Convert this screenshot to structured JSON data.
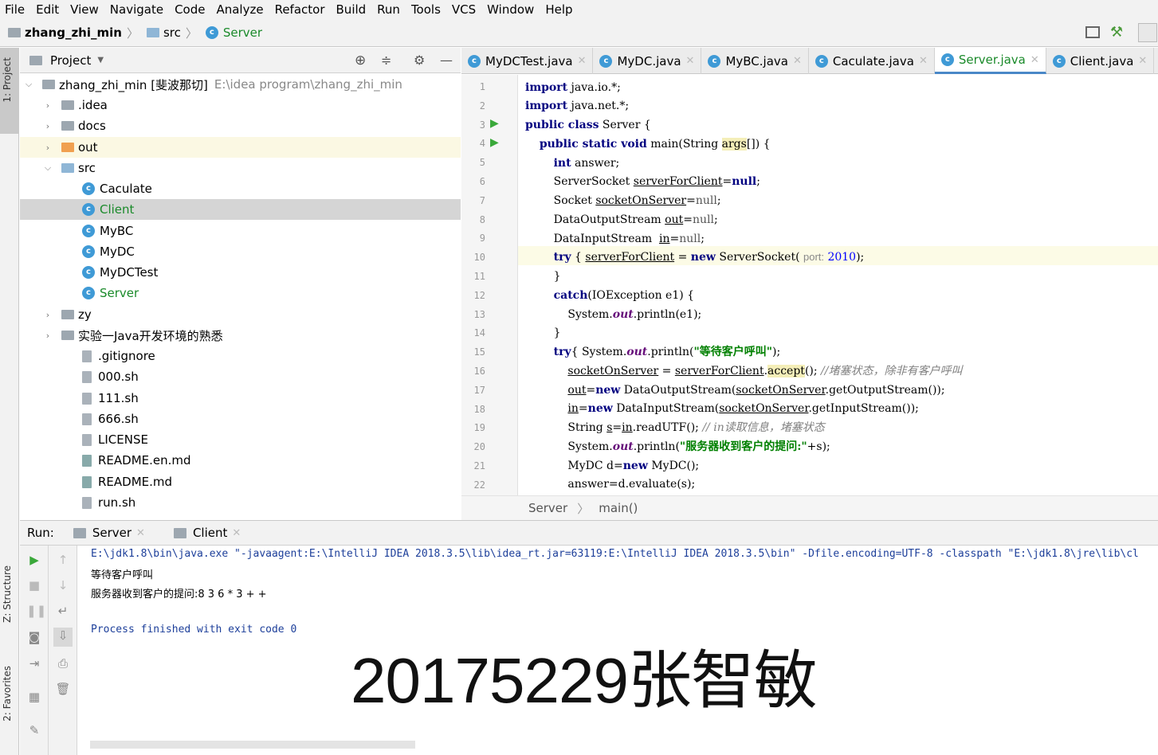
{
  "menu": [
    "File",
    "Edit",
    "View",
    "Navigate",
    "Code",
    "Analyze",
    "Refactor",
    "Build",
    "Run",
    "Tools",
    "VCS",
    "Window",
    "Help"
  ],
  "breadcrumb": {
    "project": "zhang_zhi_min",
    "folder": "src",
    "file": "Server"
  },
  "sidebar": {
    "project_tab": "1: Project",
    "structure_tab": "Z: Structure",
    "favorites_tab": "2: Favorites"
  },
  "project_panel": {
    "title": "Project",
    "root_name": "zhang_zhi_min [斐波那切]",
    "root_path": "E:\\idea program\\zhang_zhi_min",
    "items": [
      {
        "label": ".idea",
        "kind": "folder"
      },
      {
        "label": "docs",
        "kind": "folder"
      },
      {
        "label": "out",
        "kind": "folder-orange"
      },
      {
        "label": "src",
        "kind": "folder-open"
      },
      {
        "label": "Caculate",
        "kind": "class"
      },
      {
        "label": "Client",
        "kind": "class-selected"
      },
      {
        "label": "MyBC",
        "kind": "class"
      },
      {
        "label": "MyDC",
        "kind": "class"
      },
      {
        "label": "MyDCTest",
        "kind": "class"
      },
      {
        "label": "Server",
        "kind": "class"
      },
      {
        "label": "zy",
        "kind": "folder"
      },
      {
        "label": "实验一Java开发环境的熟悉",
        "kind": "folder"
      },
      {
        "label": ".gitignore",
        "kind": "file"
      },
      {
        "label": "000.sh",
        "kind": "file"
      },
      {
        "label": "111.sh",
        "kind": "file"
      },
      {
        "label": "666.sh",
        "kind": "file"
      },
      {
        "label": "LICENSE",
        "kind": "file"
      },
      {
        "label": "README.en.md",
        "kind": "md"
      },
      {
        "label": "README.md",
        "kind": "md"
      },
      {
        "label": "run.sh",
        "kind": "file"
      }
    ]
  },
  "editor_tabs": [
    {
      "label": "MyDCTest.java"
    },
    {
      "label": "MyDC.java"
    },
    {
      "label": "MyBC.java"
    },
    {
      "label": "Caculate.java"
    },
    {
      "label": "Server.java",
      "active": true
    },
    {
      "label": "Client.java"
    }
  ],
  "code_lines": [
    "1",
    "2",
    "3",
    "4",
    "5",
    "6",
    "7",
    "8",
    "9",
    "10",
    "11",
    "12",
    "13",
    "14",
    "15",
    "16",
    "17",
    "18",
    "19",
    "20",
    "21",
    "22"
  ],
  "editor_footer": {
    "class": "Server",
    "method": "main()"
  },
  "run_panel": {
    "label": "Run:",
    "tabs": [
      "Server",
      "Client"
    ],
    "console": [
      "E:\\jdk1.8\\bin\\java.exe \"-javaagent:E:\\IntelliJ IDEA 2018.3.5\\lib\\idea_rt.jar=63119:E:\\IntelliJ IDEA 2018.3.5\\bin\" -Dfile.encoding=UTF-8 -classpath \"E:\\jdk1.8\\jre\\lib\\cl",
      "等待客户呼叫",
      "服务器收到客户的提问:8 3 6 * 3 + +",
      "",
      "Process finished with exit code 0"
    ]
  },
  "overlay_text": "20175229张智敏",
  "colors": {
    "keyword": "#000080",
    "string": "#008000",
    "selection": "#d5d5d5",
    "accent": "#4a88c7"
  }
}
